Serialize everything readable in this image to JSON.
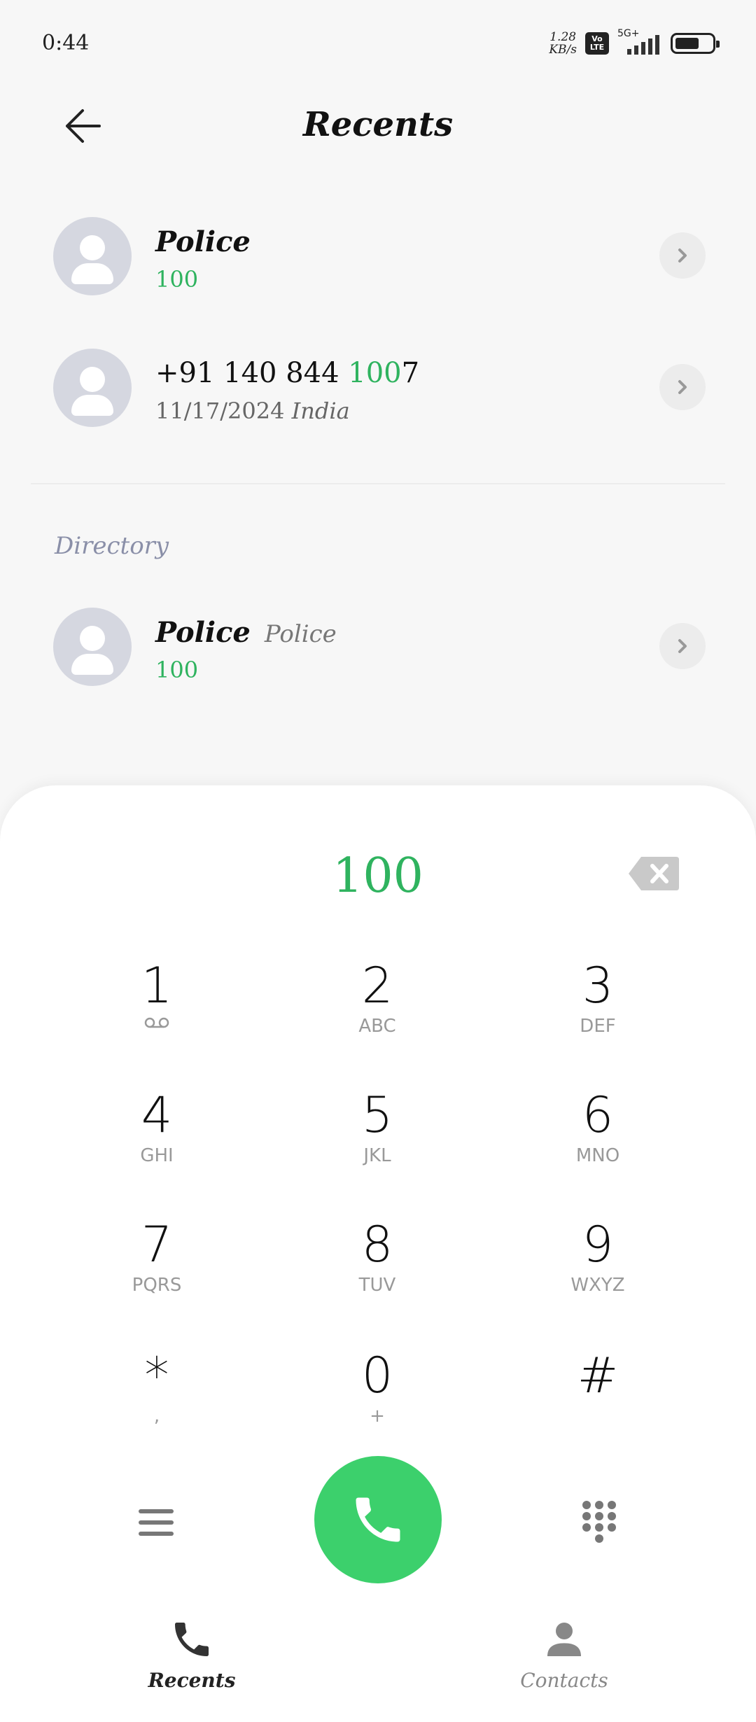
{
  "status_bar": {
    "time": "0:44",
    "net_speed_value": "1.28",
    "net_speed_unit": "KB/s",
    "volte_top": "Vo",
    "volte_bottom": "LTE",
    "signal_label": "5G+",
    "battery_level": 0.66
  },
  "header": {
    "title": "Recents",
    "back_icon": "arrow-left-icon"
  },
  "recents": [
    {
      "name": "Police",
      "number": "100"
    },
    {
      "number_prefix": "+91 140 844 ",
      "number_match": "100",
      "number_suffix": "7",
      "date": "11/17/2024",
      "location": "India"
    }
  ],
  "directory": {
    "label": "Directory",
    "items": [
      {
        "name": "Police",
        "tag": "Police",
        "number": "100"
      }
    ]
  },
  "dialer": {
    "input": "100",
    "keys": [
      {
        "digit": "1",
        "letters": ""
      },
      {
        "digit": "2",
        "letters": "ABC"
      },
      {
        "digit": "3",
        "letters": "DEF"
      },
      {
        "digit": "4",
        "letters": "GHI"
      },
      {
        "digit": "5",
        "letters": "JKL"
      },
      {
        "digit": "6",
        "letters": "MNO"
      },
      {
        "digit": "7",
        "letters": "PQRS"
      },
      {
        "digit": "8",
        "letters": "TUV"
      },
      {
        "digit": "9",
        "letters": "WXYZ"
      },
      {
        "digit": "*",
        "letters": ","
      },
      {
        "digit": "0",
        "letters": "+"
      },
      {
        "digit": "#",
        "letters": ""
      }
    ]
  },
  "bottom_nav": {
    "recents_label": "Recents",
    "contacts_label": "Contacts"
  },
  "colors": {
    "accent_green": "#2fb35f",
    "call_button": "#3cd06c"
  }
}
